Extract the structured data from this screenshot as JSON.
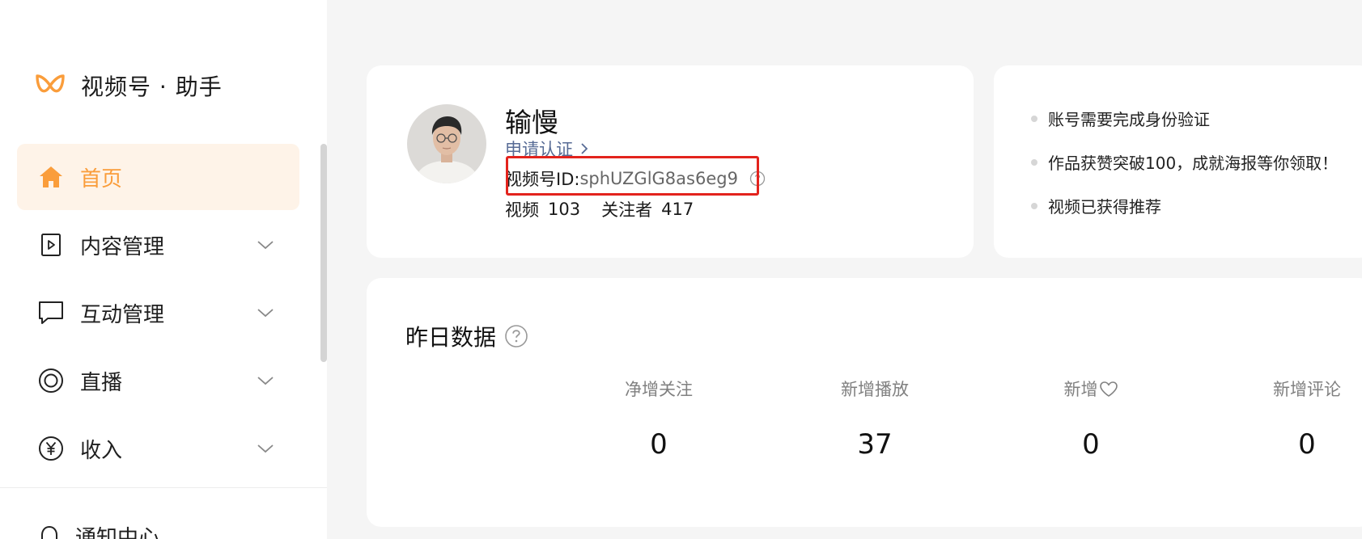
{
  "sidebar": {
    "logo_text": "视频号 · 助手",
    "items": [
      {
        "label": "首页",
        "icon": "home-icon",
        "active": true
      },
      {
        "label": "内容管理",
        "icon": "video-play-icon",
        "active": false
      },
      {
        "label": "互动管理",
        "icon": "chat-bubble-icon",
        "active": false
      },
      {
        "label": "直播",
        "icon": "live-icon",
        "active": false
      },
      {
        "label": "收入",
        "icon": "yuan-icon",
        "active": false
      }
    ],
    "notify_label": "通知中心",
    "accent_color": "#fa9d3b"
  },
  "profile": {
    "name": "输慢",
    "apply_label": "申请认证",
    "id_label": "视频号ID:",
    "id_value": "sphUZGlG8as6eg9",
    "stats": {
      "videos_label": "视频",
      "videos_count": "103",
      "followers_label": "关注者",
      "followers_count": "417"
    }
  },
  "tips": [
    "账号需要完成身份验证",
    "作品获赞突破100，成就海报等你领取！",
    "视频已获得推荐"
  ],
  "yesterday": {
    "title": "昨日数据",
    "metrics": [
      {
        "label": "净增关注",
        "value": "0"
      },
      {
        "label": "新增播放",
        "value": "37"
      },
      {
        "label": "新增",
        "value": "0",
        "icon": "heart-icon"
      },
      {
        "label": "新增评论",
        "value": "0"
      }
    ]
  },
  "colors": {
    "highlight_box": "#e3231d",
    "link": "#576b95"
  }
}
